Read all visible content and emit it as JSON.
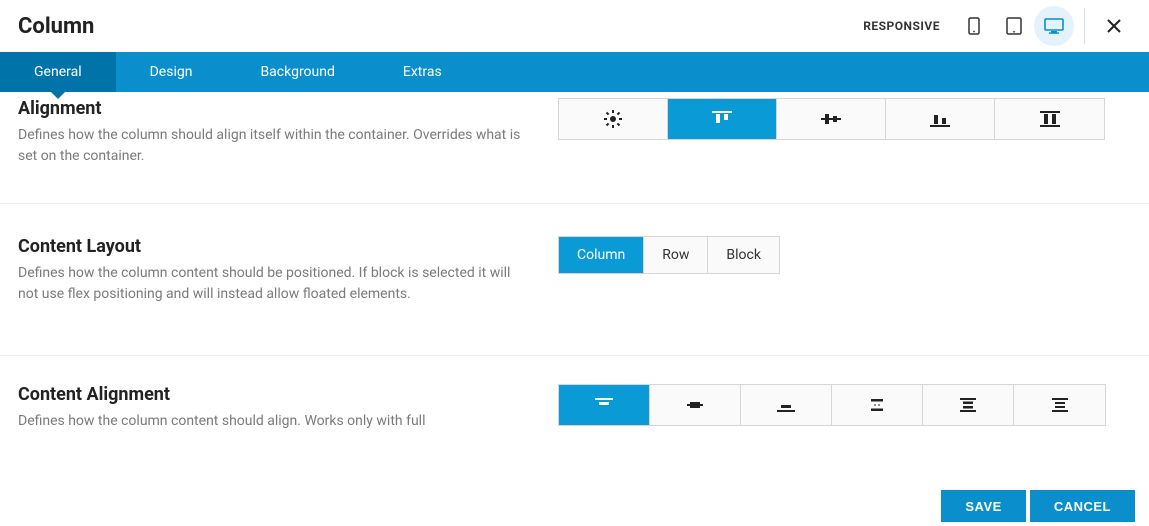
{
  "header": {
    "title": "Column",
    "responsive_label": "RESPONSIVE"
  },
  "tabs": {
    "general": "General",
    "design": "Design",
    "background": "Background",
    "extras": "Extras"
  },
  "sections": {
    "alignment": {
      "title": "Alignment",
      "desc": "Defines how the column should align itself within the container. Overrides what is set on the container."
    },
    "content_layout": {
      "title": "Content Layout",
      "desc": "Defines how the column content should be positioned. If block is selected it will not use flex positioning and will instead allow floated elements.",
      "options": {
        "column": "Column",
        "row": "Row",
        "block": "Block"
      }
    },
    "content_alignment": {
      "title": "Content Alignment",
      "desc": "Defines how the column content should align. Works only with full"
    }
  },
  "footer": {
    "save": "SAVE",
    "cancel": "CANCEL"
  }
}
